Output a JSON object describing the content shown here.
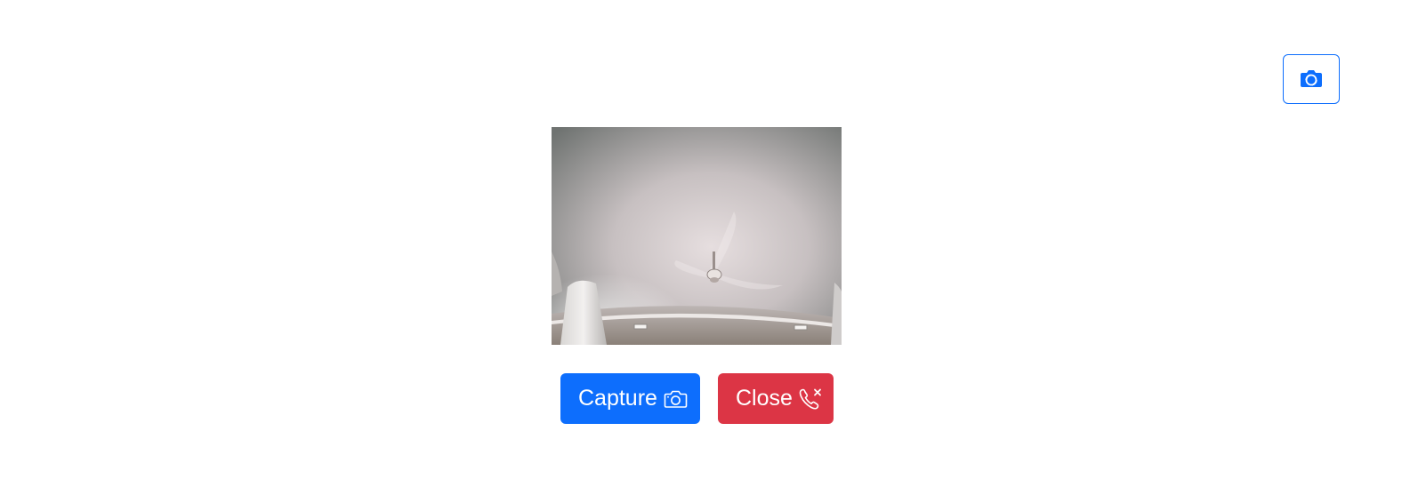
{
  "header": {
    "switch_camera_icon": "camera-flip-icon",
    "accent_color": "#0d6efd"
  },
  "video": {
    "description_icon": "webcam-feed"
  },
  "actions": {
    "capture_label": "Capture",
    "capture_icon": "camera-icon",
    "capture_color": "#0d6efd",
    "close_label": "Close",
    "close_icon": "phone-x-icon",
    "close_color": "#dc3545"
  }
}
